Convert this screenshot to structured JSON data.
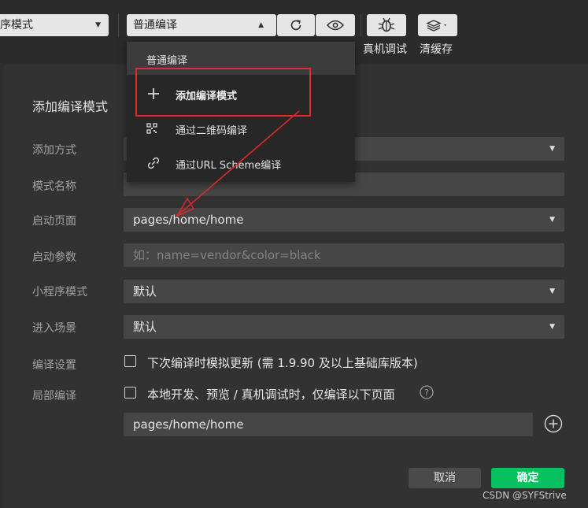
{
  "toolbar": {
    "mode_select": "序模式",
    "compile_select": "普通编译",
    "real_device_label": "真机调试",
    "clear_cache_label": "清缓存"
  },
  "menu": {
    "header": "普通编译",
    "items": [
      {
        "label": "添加编译模式",
        "icon": "plus-icon"
      },
      {
        "label": "通过二维码编译",
        "icon": "qr-code-icon"
      },
      {
        "label": "通过URL Scheme编译",
        "icon": "link-icon"
      }
    ]
  },
  "dialog": {
    "title": "添加编译模式",
    "labels": {
      "add_method": "添加方式",
      "mode_name": "模式名称",
      "start_page": "启动页面",
      "start_params": "启动参数",
      "miniprogram_mode": "小程序模式",
      "scene": "进入场景",
      "compile_settings": "编译设置",
      "partial_compile": "局部编译"
    },
    "fields": {
      "start_page_value": "pages/home/home",
      "start_params_placeholder": "如：name=vendor&color=black",
      "miniprogram_mode_value": "默认",
      "scene_value": "默认",
      "partial_page_value": "pages/home/home"
    },
    "checkboxes": {
      "simulate_update": "下次编译时模拟更新 (需 1.9.90 及以上基础库版本)",
      "partial_compile": "本地开发、预览 / 真机调试时，仅编译以下页面"
    },
    "buttons": {
      "cancel": "取消",
      "confirm": "确定"
    }
  },
  "watermark": "CSDN @SYFStrive",
  "colors": {
    "accent_green": "#07c160",
    "highlight_red": "#e02b2b",
    "arrow_red": "#d42a2a"
  }
}
